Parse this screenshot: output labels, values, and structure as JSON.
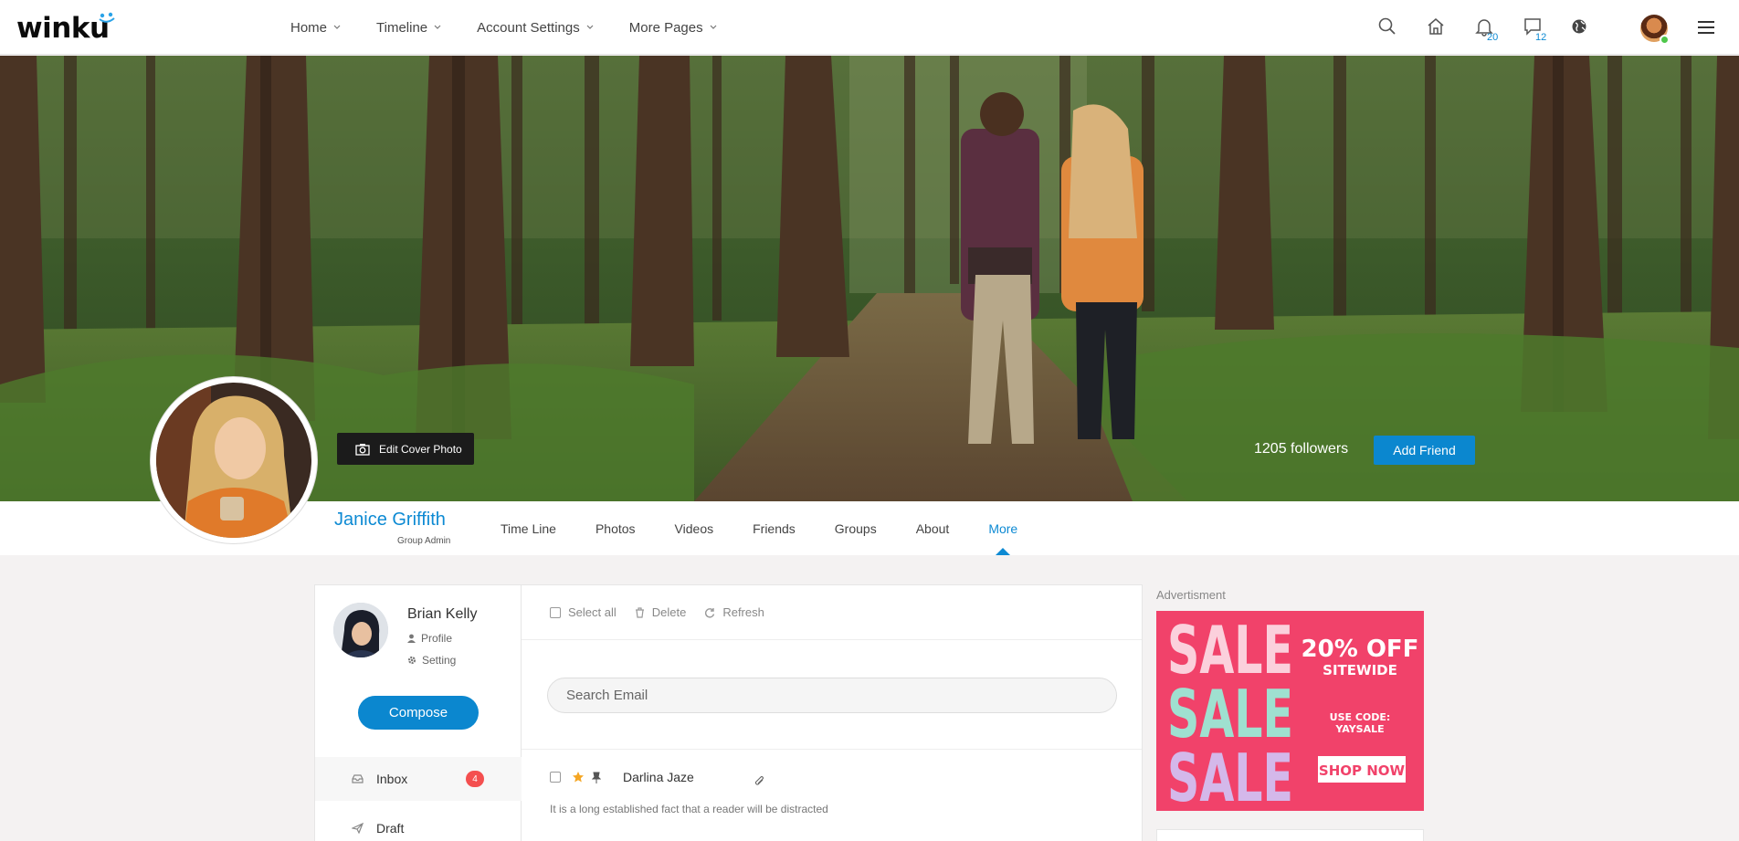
{
  "brand": {
    "logo_text": "winku"
  },
  "nav": {
    "items": [
      {
        "label": "Home"
      },
      {
        "label": "Timeline"
      },
      {
        "label": "Account Settings"
      },
      {
        "label": "More Pages"
      }
    ]
  },
  "topbar": {
    "notifications_count": "20",
    "messages_count": "12",
    "icons": [
      "search-icon",
      "home-icon",
      "bell-icon",
      "chat-icon",
      "globe-icon",
      "menu-icon"
    ]
  },
  "cover": {
    "edit_label": "Edit Cover Photo",
    "followers": "1205 followers",
    "add_friend_label": "Add Friend"
  },
  "profile": {
    "name": "Janice Griffith",
    "role": "Group Admin",
    "tabs": [
      {
        "label": "Time Line"
      },
      {
        "label": "Photos"
      },
      {
        "label": "Videos"
      },
      {
        "label": "Friends"
      },
      {
        "label": "Groups"
      },
      {
        "label": "About"
      },
      {
        "label": "More",
        "active": true
      }
    ]
  },
  "mail": {
    "user": {
      "name": "Brian Kelly",
      "profile_label": "Profile",
      "setting_label": "Setting"
    },
    "compose_label": "Compose",
    "folders": [
      {
        "label": "Inbox",
        "count": "4"
      },
      {
        "label": "Draft"
      }
    ],
    "toolbar": {
      "select_all": "Select all",
      "delete": "Delete",
      "refresh": "Refresh"
    },
    "search_placeholder": "Search Email",
    "messages": [
      {
        "from": "Darlina Jaze",
        "snippet": "It is a long established fact that a reader will be distracted",
        "starred": true,
        "pinned": true,
        "attachment": true
      }
    ]
  },
  "ad": {
    "title": "Advertisment",
    "sale_word": "SALE",
    "offer": "20% OFF",
    "offer_sub": "SITEWIDE",
    "code_label": "USE CODE:",
    "code": "YAYSALE",
    "cta": "SHOP NOW"
  },
  "colors": {
    "accent": "#0b87cf",
    "badge_red": "#f44f4f",
    "ad_pink": "#f1426a"
  }
}
